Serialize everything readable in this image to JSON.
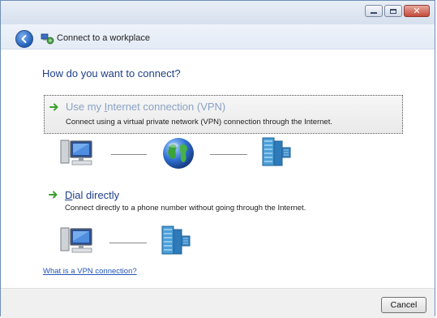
{
  "window": {
    "title": "Connect to a workplace",
    "controls": [
      "minimize",
      "maximize",
      "close"
    ]
  },
  "main": {
    "question": "How do you want to connect?",
    "options": [
      {
        "title_prefix": "Use my ",
        "title_accel": "I",
        "title_rest": "nternet connection (VPN)",
        "description": "Connect using a virtual private network (VPN) connection through the Internet.",
        "selected": true,
        "diagram": [
          "computer-icon",
          "globe-icon",
          "server-icon"
        ]
      },
      {
        "title_prefix": "",
        "title_accel": "D",
        "title_rest": "ial directly",
        "description": "Connect directly to a phone number without going through the Internet.",
        "selected": false,
        "diagram": [
          "computer-icon",
          "server-icon"
        ]
      }
    ],
    "help_link": "What is a VPN connection?"
  },
  "footer": {
    "cancel_label": "Cancel"
  },
  "colors": {
    "heading_blue": "#1e3f8a",
    "link_blue": "#2455b5",
    "selected_title": "#8aa2c5",
    "arrow_green": "#3aa12c"
  }
}
